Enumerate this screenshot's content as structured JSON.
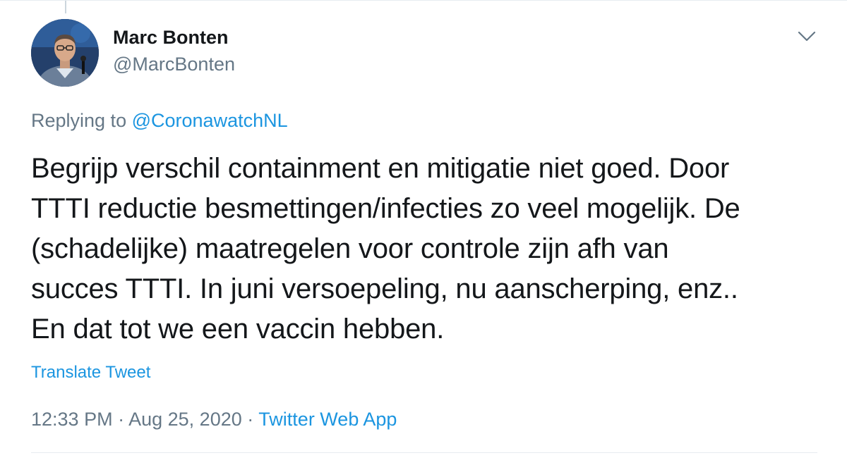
{
  "author": {
    "name": "Marc Bonten",
    "handle": "@MarcBonten"
  },
  "reply": {
    "prefix": "Replying to",
    "handle": "@CoronawatchNL"
  },
  "tweet": {
    "lines": [
      "Begrijp verschil containment en mitigatie niet goed. Door",
      "TTTI reductie besmettingen/infecties zo veel mogelijk. De",
      "(schadelijke) maatregelen voor controle zijn afh van",
      "succes TTTI. In juni versoepeling, nu aanscherping, enz..",
      "En dat tot we een vaccin hebben."
    ]
  },
  "translate_label": "Translate Tweet",
  "meta": {
    "time": "12:33 PM",
    "separator": "·",
    "date": "Aug 25, 2020",
    "source": "Twitter Web App"
  },
  "icons": {
    "menu": "chevron-down-icon"
  },
  "colors": {
    "text": "#14171a",
    "secondary": "#657786",
    "link": "#1b95e0",
    "border": "#e6ecf0"
  }
}
